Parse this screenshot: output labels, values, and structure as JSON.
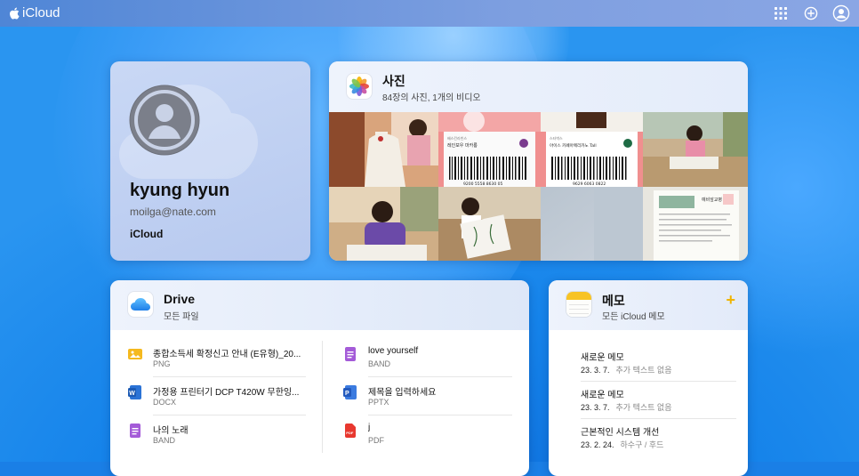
{
  "topbar": {
    "brand": "iCloud",
    "icons": [
      "app-grid-icon",
      "add-circle-icon",
      "account-icon"
    ]
  },
  "profile": {
    "name": "kyung hyun",
    "email": "moilga@nate.com",
    "service": "iCloud"
  },
  "photos": {
    "title": "사진",
    "subtitle": "84장의 사진, 1개의 비디오",
    "coupon1": {
      "brand": "배스킨라빈스",
      "item": "레인보우 마카롱",
      "code": "9200 5558 8630 05"
    },
    "coupon2": {
      "brand": "스타벅스",
      "item": "아이스 카페아메리카노 Tall",
      "code": "9629 6063 0822"
    },
    "doc": {
      "title": "예비앞교병"
    }
  },
  "drive": {
    "title": "Drive",
    "subtitle": "모든 파일",
    "files_left": [
      {
        "name": "종합소득세 확정신고 안내 (E유형)_20...",
        "type": "PNG",
        "icon": "image-file-icon"
      },
      {
        "name": "가정용 프린터기 DCP T420W 무한잉...",
        "type": "DOCX",
        "icon": "word-file-icon"
      },
      {
        "name": "나의 노래",
        "type": "BAND",
        "icon": "band-file-icon"
      }
    ],
    "files_right": [
      {
        "name": "love yourself",
        "type": "BAND",
        "icon": "band-file-icon"
      },
      {
        "name": "제목을 입력하세요",
        "type": "PPTX",
        "icon": "powerpoint-file-icon"
      },
      {
        "name": "j",
        "type": "PDF",
        "icon": "pdf-file-icon"
      }
    ]
  },
  "notes": {
    "title": "메모",
    "subtitle": "모든 iCloud 메모",
    "add_label": "+",
    "items": [
      {
        "title": "새로운 메모",
        "date": "23. 3. 7.",
        "preview": "추가 텍스트 없음"
      },
      {
        "title": "새로운 메모",
        "date": "23. 3. 7.",
        "preview": "추가 텍스트 없음"
      },
      {
        "title": "근본적인 시스템 개선",
        "date": "23. 2. 24.",
        "preview": "하수구 / 후드"
      }
    ]
  }
}
